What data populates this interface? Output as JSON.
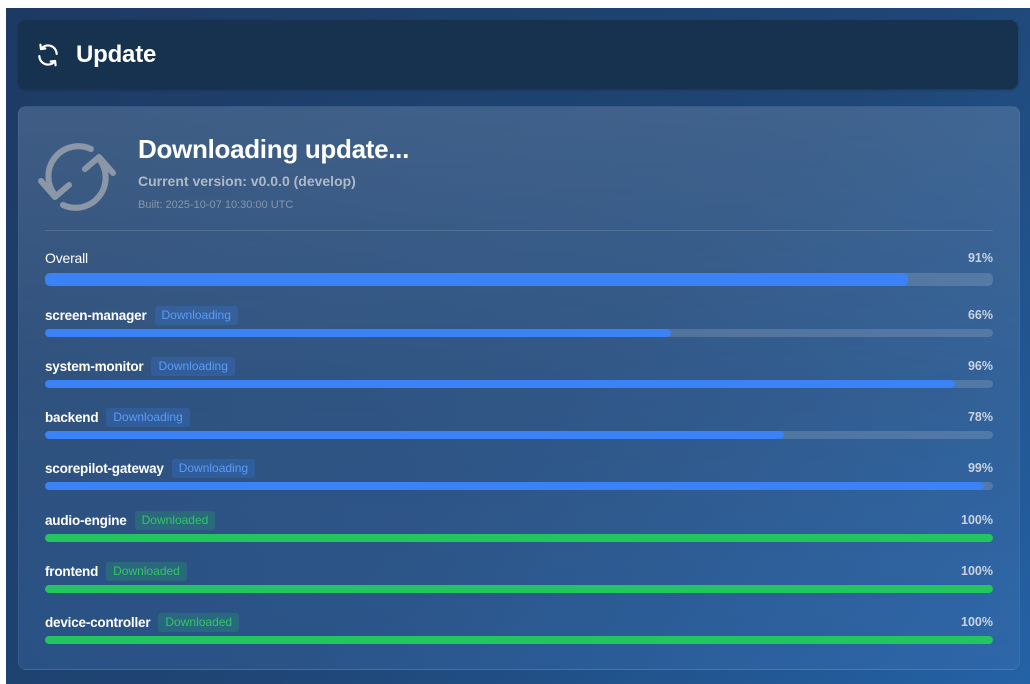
{
  "header": {
    "icon": "refresh-icon",
    "title": "Update"
  },
  "status": {
    "icon": "sync-icon",
    "title": "Downloading update...",
    "current_version": "Current version: v0.0.0 (develop)",
    "built": "Built: 2025-10-07 10:30:00 UTC"
  },
  "overall": {
    "label": "Overall",
    "percent_text": "91%",
    "progress": 91
  },
  "components": [
    {
      "name": "screen-manager",
      "status": "Downloading",
      "state": "downloading",
      "percent_text": "66%",
      "progress": 66
    },
    {
      "name": "system-monitor",
      "status": "Downloading",
      "state": "downloading",
      "percent_text": "96%",
      "progress": 96
    },
    {
      "name": "backend",
      "status": "Downloading",
      "state": "downloading",
      "percent_text": "78%",
      "progress": 78
    },
    {
      "name": "scorepilot-gateway",
      "status": "Downloading",
      "state": "downloading",
      "percent_text": "99%",
      "progress": 99
    },
    {
      "name": "audio-engine",
      "status": "Downloaded",
      "state": "downloaded",
      "percent_text": "100%",
      "progress": 100
    },
    {
      "name": "frontend",
      "status": "Downloaded",
      "state": "downloaded",
      "percent_text": "100%",
      "progress": 100
    },
    {
      "name": "device-controller",
      "status": "Downloaded",
      "state": "downloaded",
      "percent_text": "100%",
      "progress": 100
    }
  ],
  "colors": {
    "downloading": "#3b82f6",
    "downloaded": "#22c55e"
  }
}
